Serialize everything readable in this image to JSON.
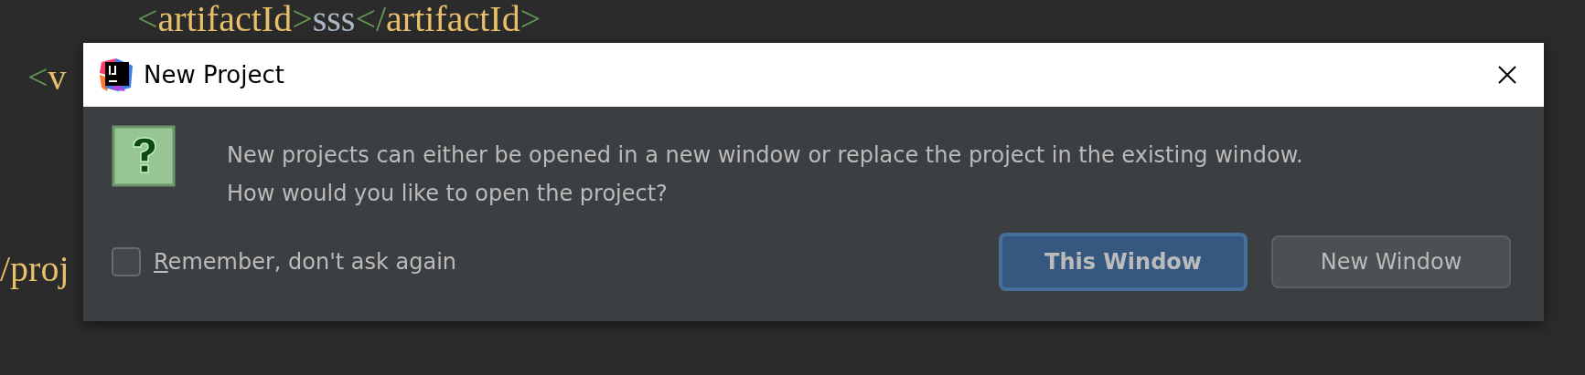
{
  "editor": {
    "lines": [
      {
        "tokens": [
          {
            "kind": "bracket",
            "text": "<"
          },
          {
            "kind": "tag",
            "text": "artifactId"
          },
          {
            "kind": "bracket",
            "text": ">"
          },
          {
            "kind": "value",
            "text": "sss"
          },
          {
            "kind": "bracket",
            "text": "</"
          },
          {
            "kind": "tag",
            "text": "artifactId"
          },
          {
            "kind": "bracket",
            "text": ">"
          }
        ]
      },
      {
        "tokens": [
          {
            "kind": "bracket",
            "text": "<"
          },
          {
            "kind": "tag",
            "text": "v"
          }
        ]
      },
      {
        "tokens": [
          {
            "kind": "tag",
            "text": "/proj"
          }
        ]
      }
    ]
  },
  "dialog": {
    "title": "New Project",
    "message": [
      "New projects can either be opened in a new window or replace the project in the existing window.",
      "How would you like to open the project?"
    ],
    "checkbox": {
      "label": "Remember, don't ask again",
      "checked": false
    },
    "buttons": [
      {
        "label": "This Window",
        "selected": true
      },
      {
        "label": "New Window",
        "selected": false
      }
    ]
  }
}
